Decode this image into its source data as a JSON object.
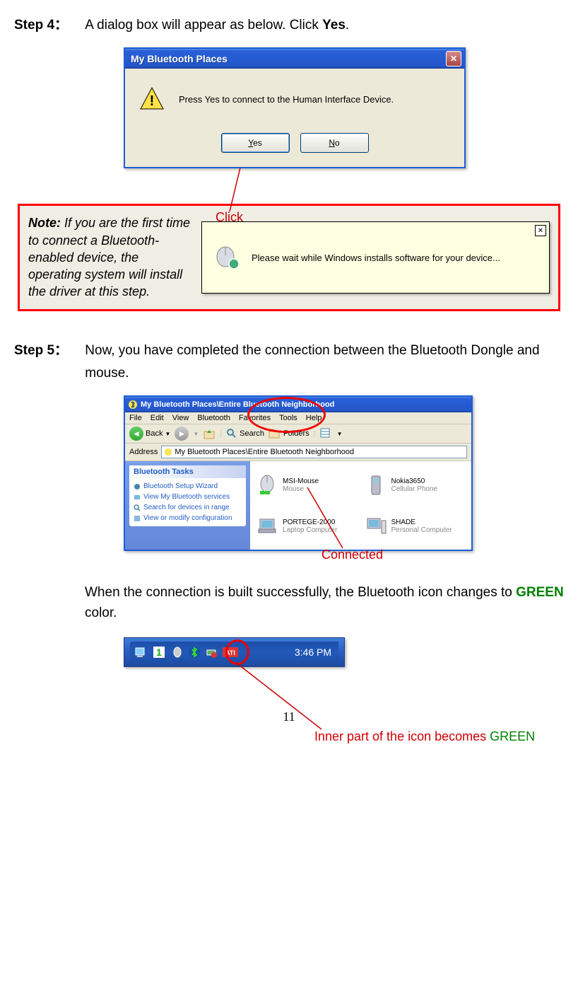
{
  "step4": {
    "label": "Step 4：",
    "text_before_yes": "A dialog box will appear as below. Click ",
    "yes_word": "Yes",
    "period": "."
  },
  "dialog1": {
    "title": "My Bluetooth Places",
    "message": "Press Yes to connect to the Human Interface Device.",
    "yes_btn": "Yes",
    "no_btn": "No"
  },
  "click_label": "Click",
  "note": {
    "prefix": "Note:",
    "body": " If you are the first time to connect a Bluetooth-enabled device, the operating system will install the driver at this step."
  },
  "balloon_text": "Please wait while Windows installs software for your device...",
  "step5": {
    "label": "Step 5：",
    "text": "Now, you have completed the connection between the Bluetooth Dongle and mouse."
  },
  "explorer": {
    "title": "My Bluetooth Places\\Entire Bluetooth Neighborhood",
    "menu": [
      "File",
      "Edit",
      "View",
      "Bluetooth",
      "Favorites",
      "Tools",
      "Help"
    ],
    "back": "Back",
    "search": "Search",
    "folders": "Folders",
    "address_label": "Address",
    "address_path": "My Bluetooth Places\\Entire Bluetooth Neighborhood",
    "tasks_header": "Bluetooth Tasks",
    "tasks": [
      "Bluetooth Setup Wizard",
      "View My Bluetooth services",
      "Search for devices in range",
      "View or modify configuration"
    ],
    "devices": [
      {
        "name": "MSI-Mouse",
        "type": "Mouse"
      },
      {
        "name": "Nokia3650",
        "type": "Cellular Phone"
      },
      {
        "name": "PORTEGE-2000",
        "type": "Laptop Computer"
      },
      {
        "name": "SHADE",
        "type": "Personal Computer"
      }
    ]
  },
  "connected_label": "Connected",
  "after_explorer": {
    "text1": "When the connection is built successfully, the Bluetooth icon changes to ",
    "green_word": "GREEN",
    "text2": " color."
  },
  "tray": {
    "time": "3:46 PM"
  },
  "tray_label_prefix": "Inner part of the icon becomes ",
  "tray_label_green": "GREEN",
  "page_number": "11"
}
